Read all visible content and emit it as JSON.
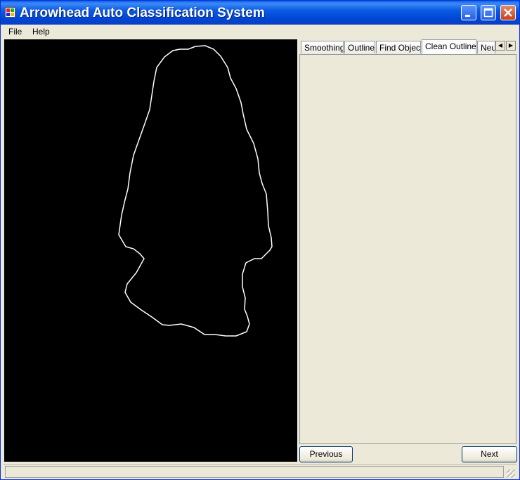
{
  "window": {
    "title": "Arrowhead Auto Classification System"
  },
  "menu": {
    "items": [
      "File",
      "Help"
    ]
  },
  "tabs": {
    "items": [
      "Smoothing",
      "Outline",
      "Find Object",
      "Clean Outline",
      "Neu"
    ],
    "active": "Clean Outline"
  },
  "buttons": {
    "previous": "Previous",
    "next": "Next"
  },
  "colors": {
    "titlebar": "#0a5fe8",
    "canvas": "#000000",
    "outline": "#ffffff",
    "close_button": "#c8401f"
  },
  "icons": {
    "minimize": "minimize-icon",
    "maximize": "maximize-icon",
    "close": "close-icon",
    "scroll_left": "arrow-left-icon",
    "scroll_right": "arrow-right-icon"
  }
}
